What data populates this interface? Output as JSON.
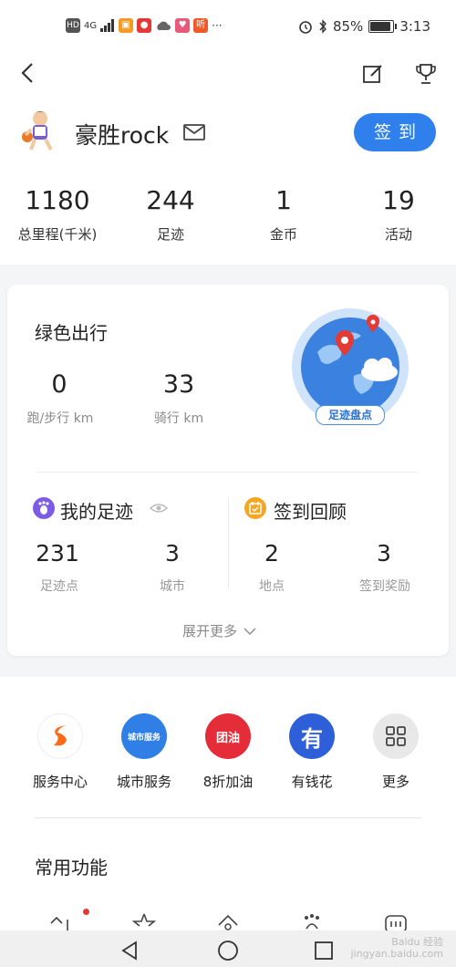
{
  "status_bar": {
    "network": "4G",
    "battery": "85%",
    "time": "3:13",
    "battery_level": 0.85,
    "more": "···",
    "app_icons": [
      {
        "name": "hd-icon",
        "color": "#555555"
      },
      {
        "name": "orange-app-icon",
        "color": "#f59b23"
      },
      {
        "name": "red-mic-icon",
        "color": "#e53935"
      },
      {
        "name": "cloud-icon",
        "color": "#666666"
      },
      {
        "name": "pink-app-icon",
        "color": "#e85a7a"
      },
      {
        "name": "listen-icon",
        "color": "#f05a28"
      }
    ],
    "listen_label": "听"
  },
  "header": {
    "username": "豪胜rock",
    "signin_label": "签到",
    "stats": [
      {
        "value": "1180",
        "label": "总里程(千米)"
      },
      {
        "value": "244",
        "label": "足迹"
      },
      {
        "value": "1",
        "label": "金币"
      },
      {
        "value": "19",
        "label": "活动"
      }
    ]
  },
  "green_travel": {
    "title": "绿色出行",
    "items": [
      {
        "value": "0",
        "label": "跑/步行 km"
      },
      {
        "value": "33",
        "label": "骑行 km"
      }
    ],
    "globe_label": "足迹盘点"
  },
  "footprint": {
    "title": "我的足迹",
    "items": [
      {
        "value": "231",
        "label": "足迹点"
      },
      {
        "value": "3",
        "label": "城市"
      }
    ]
  },
  "checkin_review": {
    "title": "签到回顾",
    "items": [
      {
        "value": "2",
        "label": "地点"
      },
      {
        "value": "3",
        "label": "签到奖励"
      }
    ]
  },
  "expand_label": "展开更多",
  "services": [
    {
      "label": "服务中心",
      "icon": "service-center-icon",
      "color": "#ffffff",
      "glyph": "S"
    },
    {
      "label": "城市服务",
      "icon": "city-service-icon",
      "color": "#2f7fe6",
      "glyph": "城市服务"
    },
    {
      "label": "8折加油",
      "icon": "fuel-icon",
      "color": "#e52d3a",
      "glyph": "团油"
    },
    {
      "label": "有钱花",
      "icon": "loan-icon",
      "color": "#2f5fd8",
      "glyph": "有"
    },
    {
      "label": "更多",
      "icon": "more-grid-icon",
      "color": "#e8e8e8",
      "glyph": ""
    }
  ],
  "common_title": "常用功能",
  "colors": {
    "accent": "#2f80ed",
    "footprint_icon": "#7c5ce6",
    "checkin_icon": "#f5a623"
  },
  "watermark": "Baidu 经验\njingyan.baidu.com"
}
